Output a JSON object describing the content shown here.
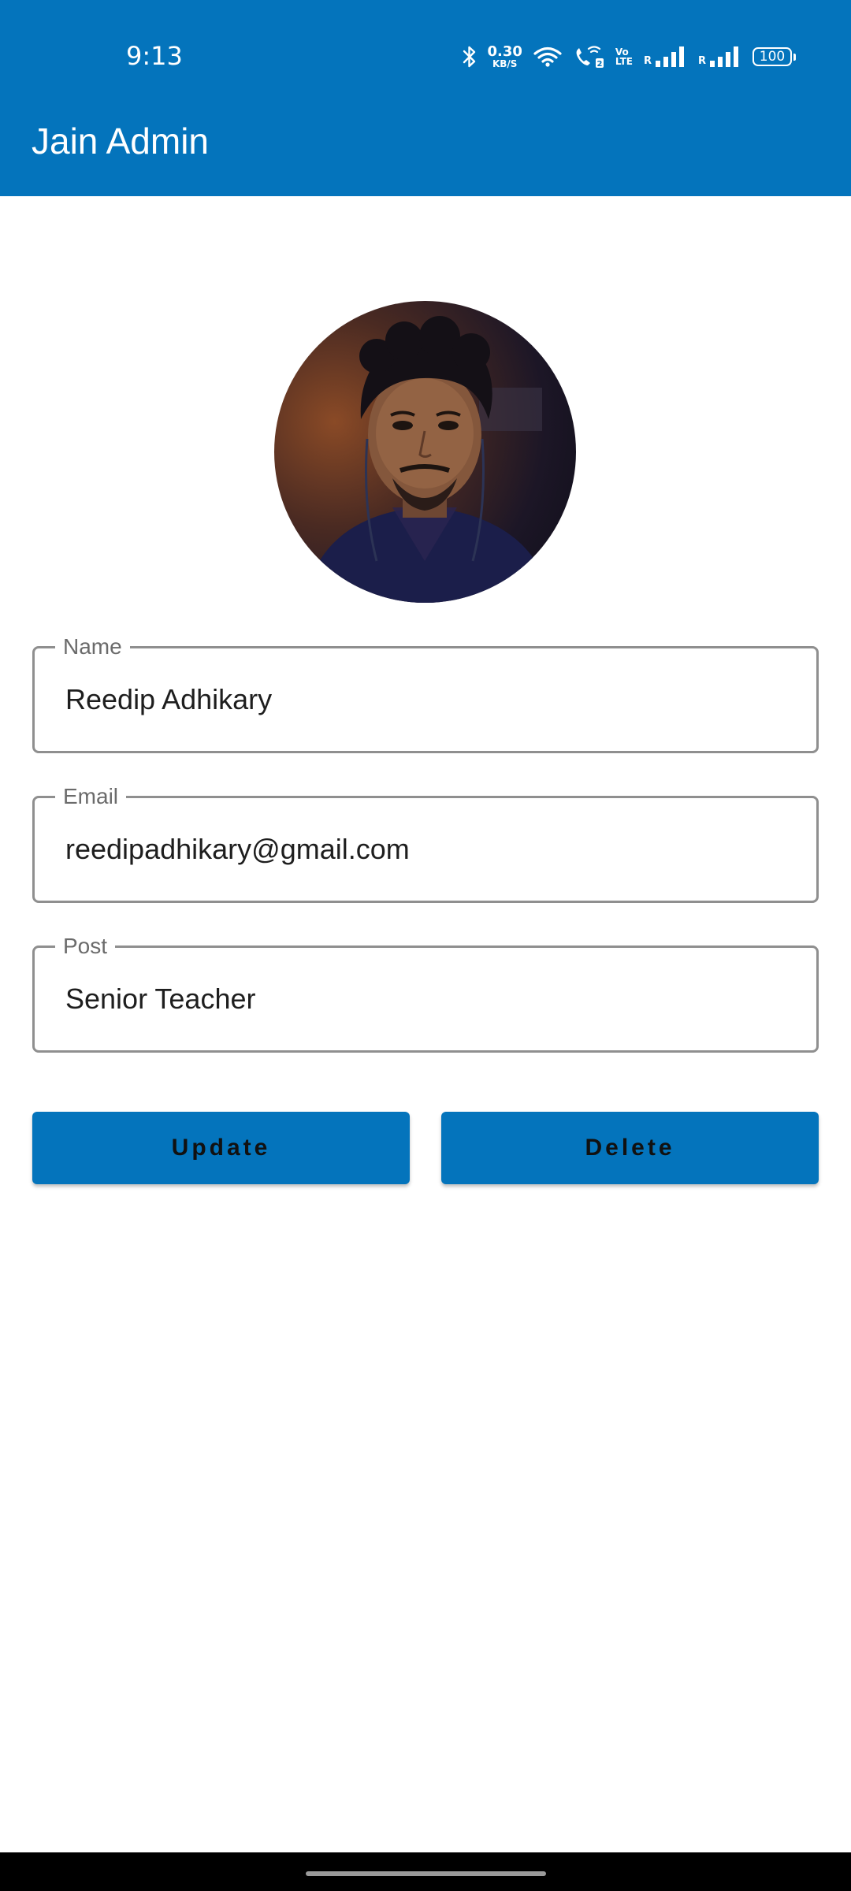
{
  "status_bar": {
    "time": "9:13",
    "net_speed_value": "0.30",
    "net_speed_unit": "KB/S",
    "volte_top": "Vo",
    "volte_bottom": "LTE",
    "signal_1_label": "R",
    "signal_2_label": "R",
    "battery": "100",
    "icons": [
      "bluetooth-icon",
      "wifi-icon",
      "wifi-call-icon",
      "signal-icon",
      "battery-icon"
    ]
  },
  "app_bar": {
    "title": "Jain Admin",
    "color": "#0474BC"
  },
  "profile": {
    "avatar": "profile-photo"
  },
  "form": {
    "name": {
      "label": "Name",
      "value": "Reedip Adhikary"
    },
    "email": {
      "label": "Email",
      "value": "reedipadhikary@gmail.com"
    },
    "post": {
      "label": "Post",
      "value": "Senior Teacher"
    }
  },
  "actions": {
    "update_label": "Update",
    "delete_label": "Delete",
    "color": "#0474BC"
  }
}
